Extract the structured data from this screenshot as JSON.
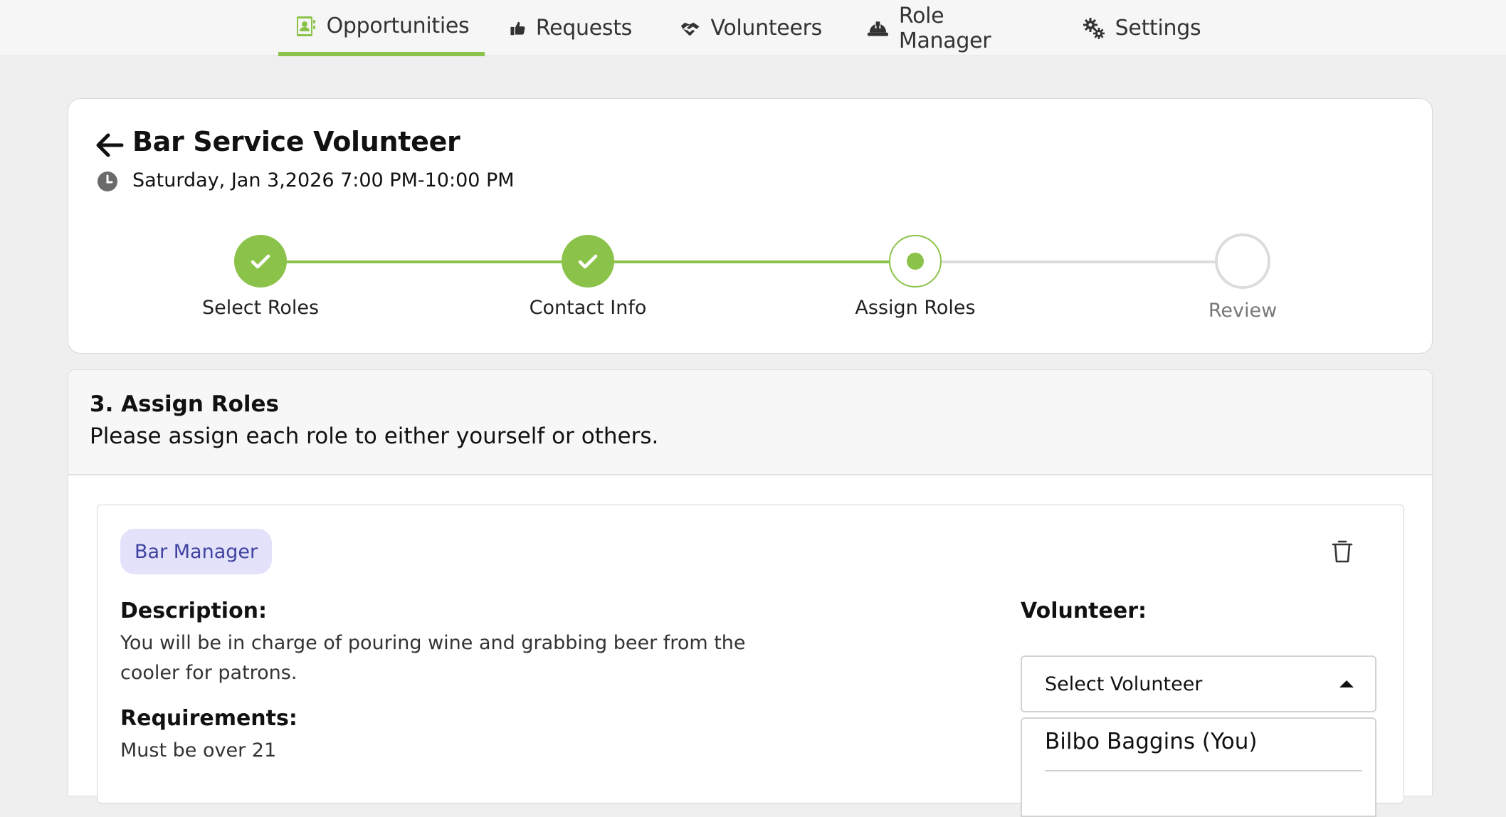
{
  "nav": {
    "items": [
      {
        "label": "Opportunities",
        "icon": "contact-book-icon",
        "active": true
      },
      {
        "label": "Requests",
        "icon": "thumbs-up-icon",
        "active": false
      },
      {
        "label": "Volunteers",
        "icon": "handshake-icon",
        "active": false
      },
      {
        "label": "Role Manager",
        "icon": "hard-hat-icon",
        "active": false
      },
      {
        "label": "Settings",
        "icon": "gears-icon",
        "active": false
      }
    ]
  },
  "opportunity": {
    "title": "Bar Service Volunteer",
    "datetime": "Saturday, Jan 3,2026 7:00 PM-10:00 PM"
  },
  "steps": [
    {
      "label": "Select Roles",
      "status": "done"
    },
    {
      "label": "Contact Info",
      "status": "done"
    },
    {
      "label": "Assign Roles",
      "status": "current"
    },
    {
      "label": "Review",
      "status": "todo"
    }
  ],
  "assign": {
    "title": "3. Assign Roles",
    "subtitle": "Please assign each role to either yourself or others."
  },
  "role": {
    "badge": "Bar Manager",
    "description_label": "Description:",
    "description_line1": "You will be in charge of pouring wine and grabbing beer from the",
    "description_line2": "cooler for patrons.",
    "requirements_label": "Requirements:",
    "requirements": "Must be over 21",
    "volunteer_label": "Volunteer:",
    "select_placeholder": "Select Volunteer",
    "options": [
      "Bilbo Baggins (You)"
    ]
  },
  "colors": {
    "accent": "#8bc34a",
    "badge_bg": "#e4e2fb",
    "badge_text": "#3f42a0"
  }
}
